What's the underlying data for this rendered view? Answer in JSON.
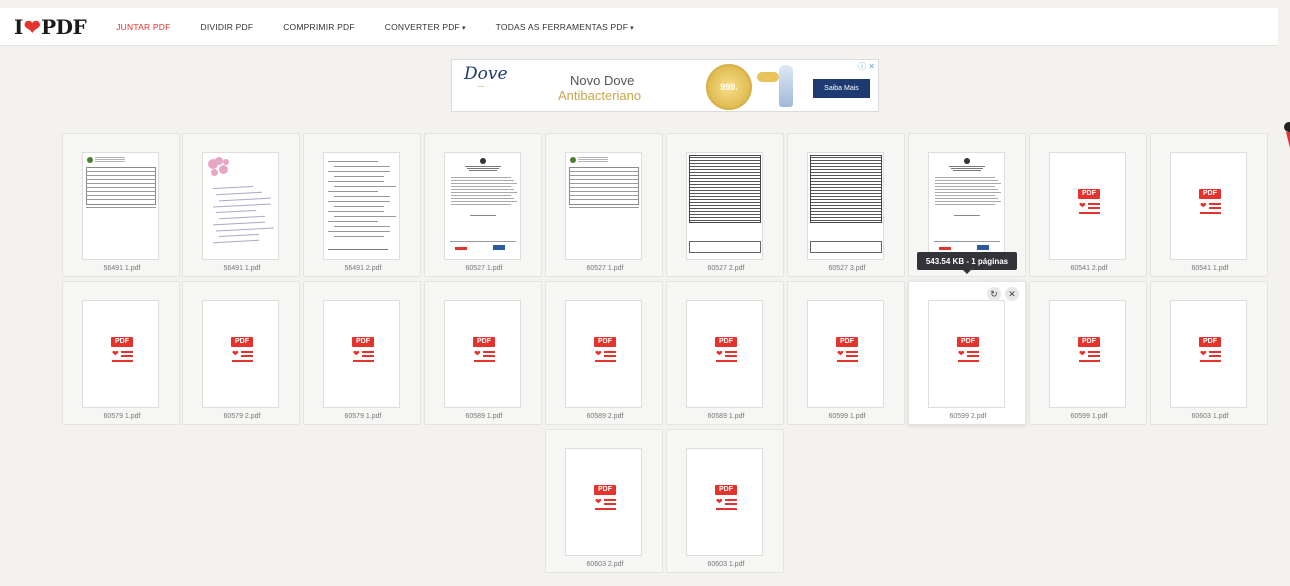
{
  "header": {
    "logo_left": "I",
    "logo_right": "PDF",
    "nav": [
      {
        "label": "JUNTAR PDF",
        "active": true,
        "dropdown": false
      },
      {
        "label": "DIVIDIR PDF",
        "active": false,
        "dropdown": false
      },
      {
        "label": "COMPRIMIR PDF",
        "active": false,
        "dropdown": false
      },
      {
        "label": "CONVERTER PDF",
        "active": false,
        "dropdown": true
      },
      {
        "label": "TODAS AS FERRAMENTAS PDF",
        "active": false,
        "dropdown": true
      }
    ]
  },
  "ad": {
    "brand": "Dove",
    "line1": "Novo Dove",
    "line2": "Antibacteriano",
    "seal": "999.",
    "cta": "Saiba Mais"
  },
  "files": [
    {
      "name": "56491 1.pdf",
      "preview": "form"
    },
    {
      "name": "56491 1.pdf",
      "preview": "handwritten"
    },
    {
      "name": "56491 2.pdf",
      "preview": "scan"
    },
    {
      "name": "60527 1.pdf",
      "preview": "letter"
    },
    {
      "name": "60527 1.pdf",
      "preview": "form"
    },
    {
      "name": "60527 2.pdf",
      "preview": "dense"
    },
    {
      "name": "60527 3.pdf",
      "preview": "dense"
    },
    {
      "name": "",
      "preview": "letter"
    },
    {
      "name": "60541 2.pdf",
      "preview": "icon"
    },
    {
      "name": "60541 1.pdf",
      "preview": "icon"
    },
    {
      "name": "60579 1.pdf",
      "preview": "icon"
    },
    {
      "name": "60579 2.pdf",
      "preview": "icon"
    },
    {
      "name": "60579 1.pdf",
      "preview": "icon"
    },
    {
      "name": "60589 1.pdf",
      "preview": "icon"
    },
    {
      "name": "60589 2.pdf",
      "preview": "icon"
    },
    {
      "name": "60589 1.pdf",
      "preview": "icon"
    },
    {
      "name": "60599 1.pdf",
      "preview": "icon"
    },
    {
      "name": "60599 2.pdf",
      "preview": "icon",
      "hover": true
    },
    {
      "name": "60599 1.pdf",
      "preview": "icon"
    },
    {
      "name": "60603 1.pdf",
      "preview": "icon"
    },
    {
      "name": "60603 2.pdf",
      "preview": "icon"
    },
    {
      "name": "60603 1.pdf",
      "preview": "icon"
    }
  ],
  "pdf_badge": "PDF",
  "tooltip": "543.54 KB - 1 páginas",
  "colors": {
    "brand_red": "#e5322d",
    "tooltip_bg": "#33333a",
    "ad_navy": "#1d3b72",
    "ad_gold": "#c9a64f"
  }
}
